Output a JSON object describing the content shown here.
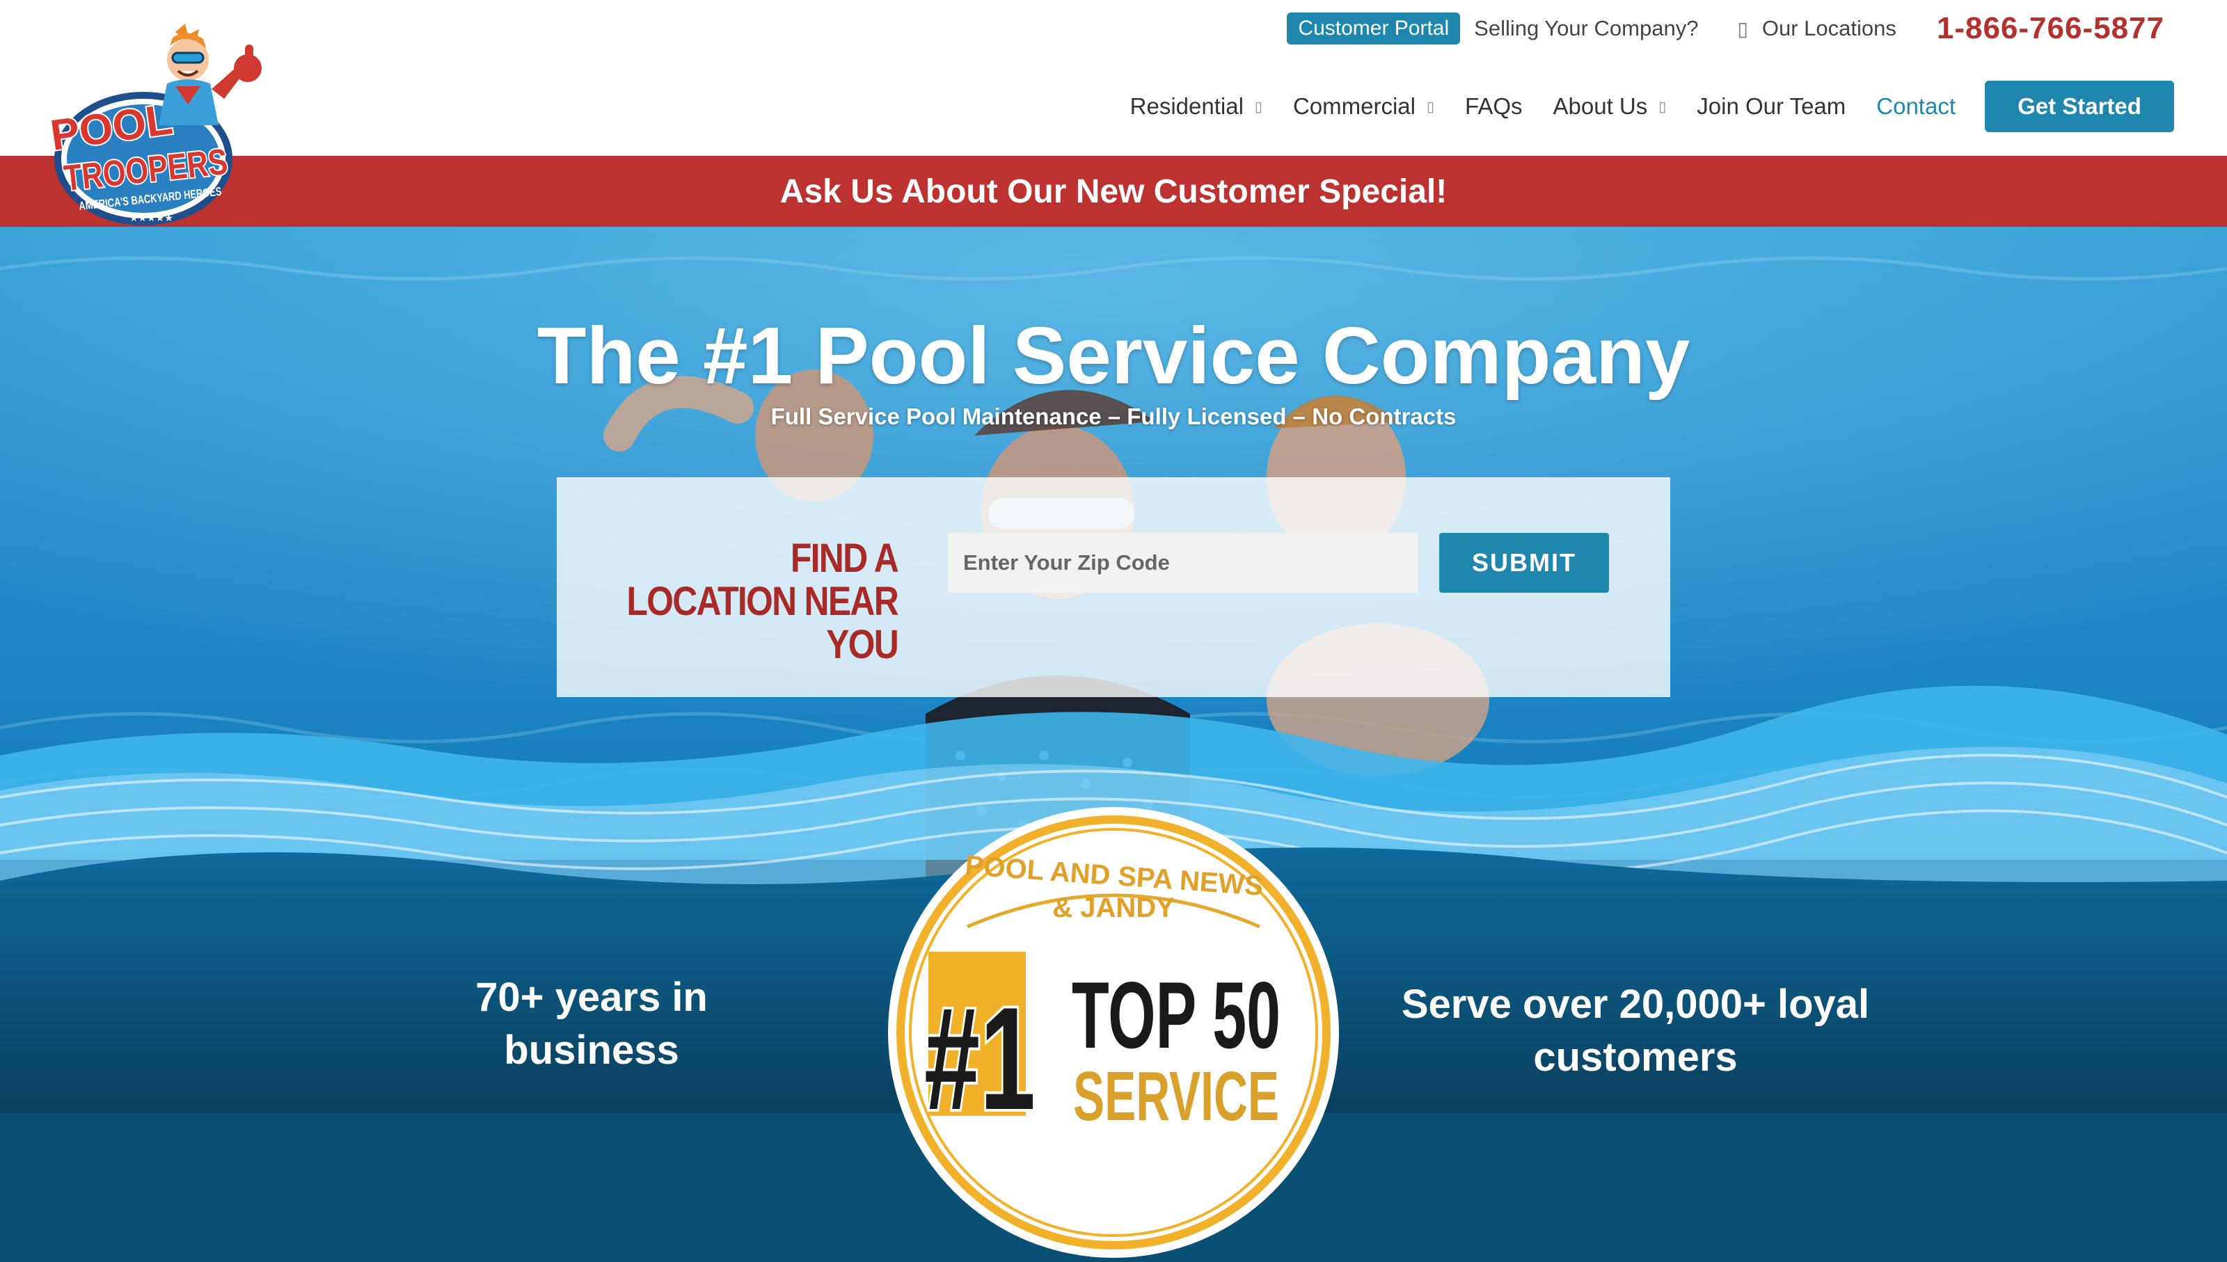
{
  "brand": {
    "logo_main": "POOL TROOPERS",
    "logo_tagline": "AMERICA'S BACKYARD HEROES"
  },
  "topbar": {
    "portal_label": "Customer Portal",
    "selling_label": "Selling Your Company?",
    "locations_label": "Our Locations",
    "phone": "1-866-766-5877"
  },
  "nav": {
    "residential": "Residential",
    "commercial": "Commercial",
    "faqs": "FAQs",
    "about": "About Us",
    "join": "Join Our Team",
    "contact": "Contact",
    "cta": "Get Started"
  },
  "promo": {
    "text": "Ask Us About Our New Customer Special!"
  },
  "hero": {
    "title": "The #1 Pool Service Company",
    "subtitle": "Full Service Pool Maintenance – Fully Licensed – No Contracts"
  },
  "finder": {
    "heading": "FIND A LOCATION NEAR YOU",
    "zip_placeholder": "Enter Your Zip Code",
    "submit_label": "SUBMIT"
  },
  "stats": {
    "left": "70+ years in business",
    "right": "Serve over 20,000+ loyal customers"
  },
  "badge": {
    "line1": "POOL AND SPA NEWS",
    "line2": "& JANDY",
    "rank": "#1",
    "main": "TOP 50",
    "sub": "SERVICE"
  },
  "colors": {
    "brand_blue": "#1f86ad",
    "brand_red": "#bc3230",
    "phone_red": "#b3302d",
    "badge_gold": "#f2b12a"
  }
}
